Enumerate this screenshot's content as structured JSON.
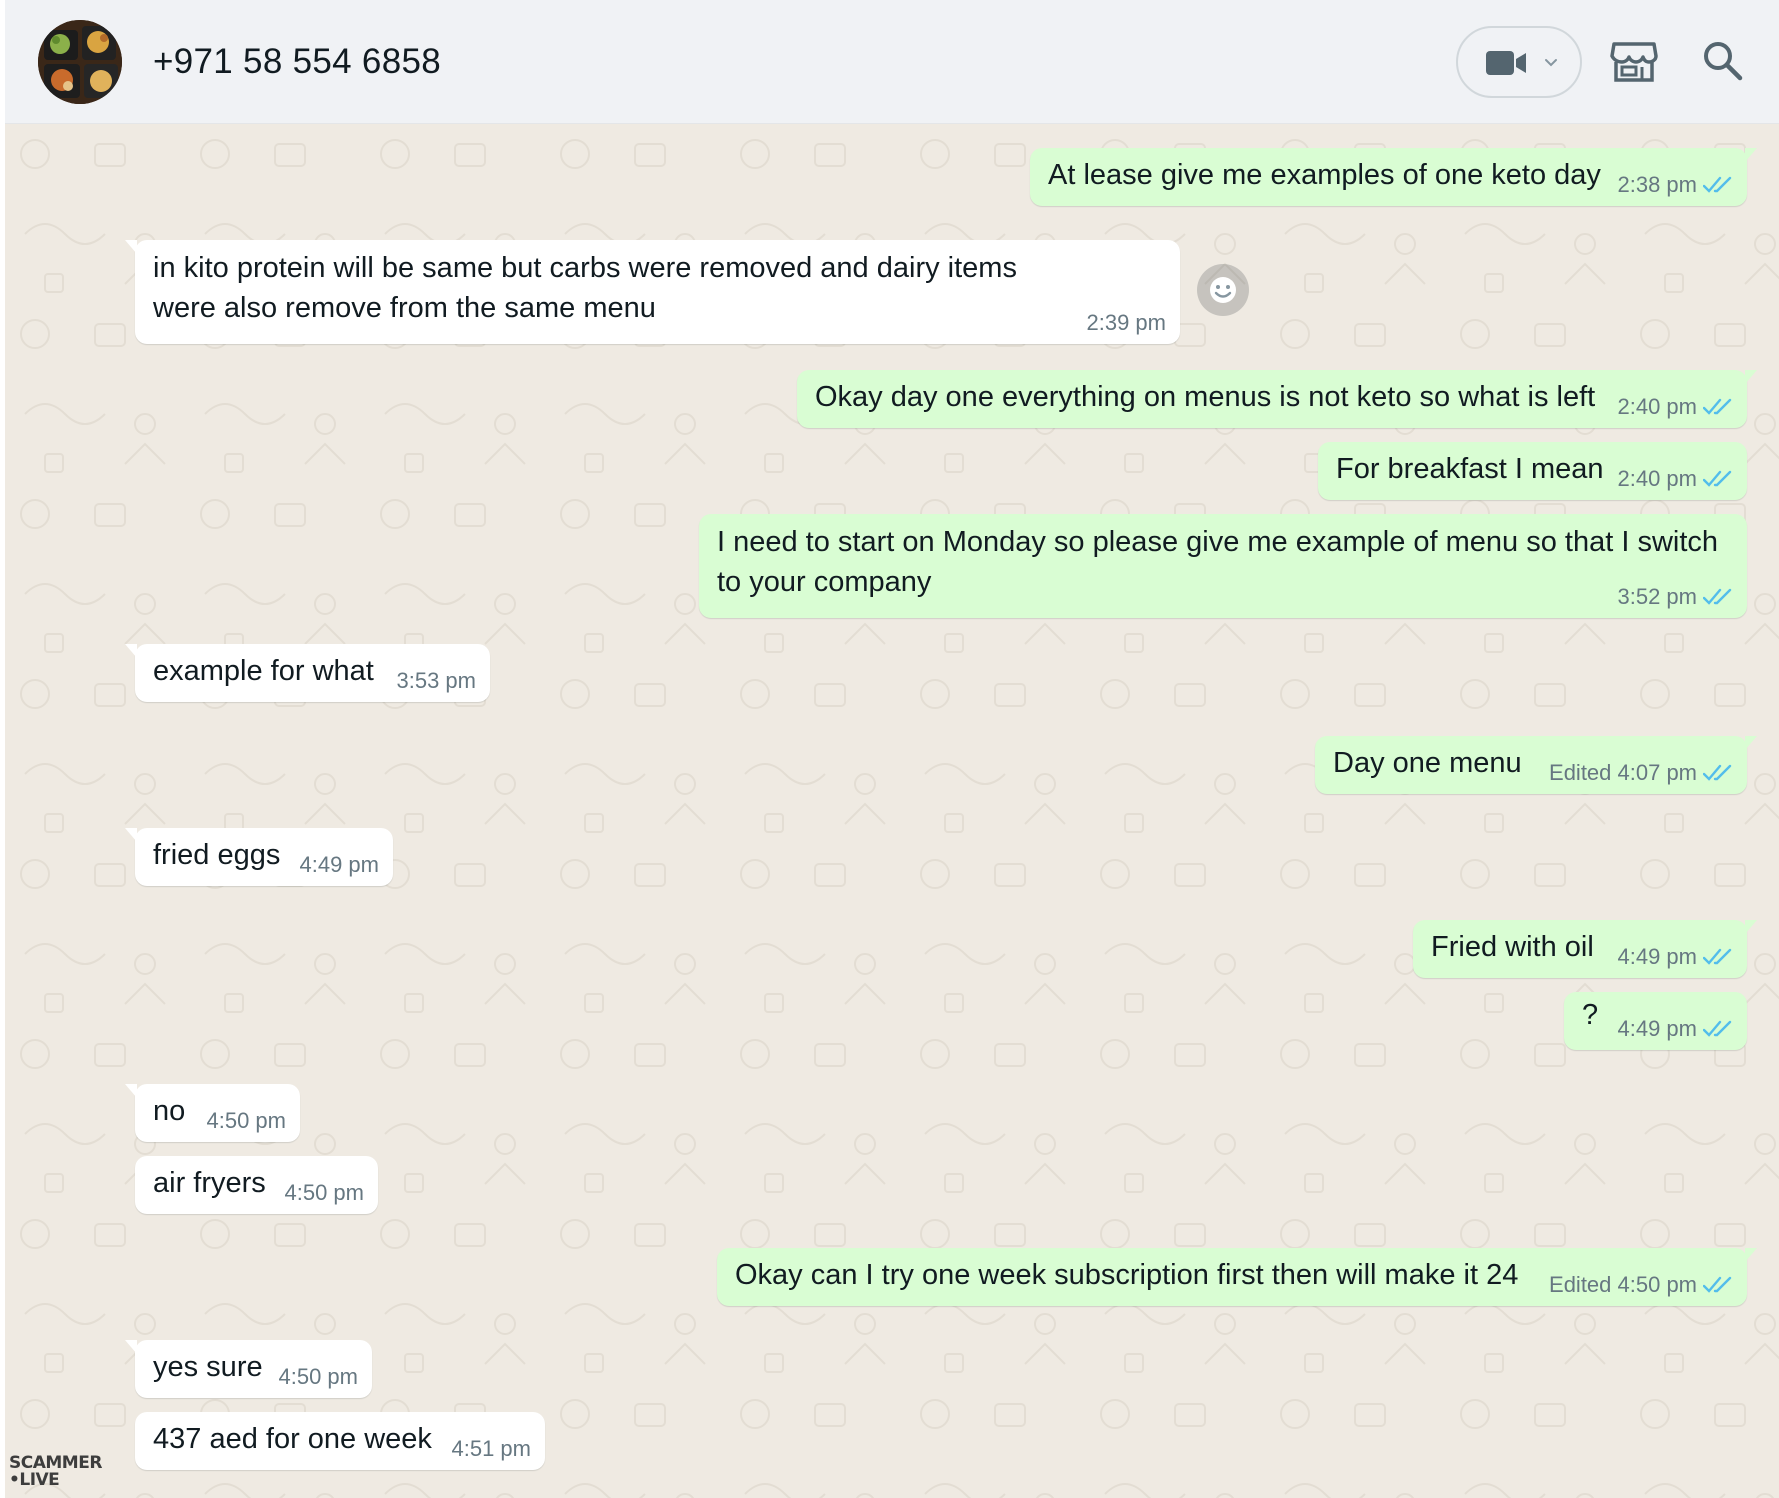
{
  "header": {
    "contact": "+971 58 554 6858",
    "icons": [
      "video-call-icon",
      "chevron-down-icon",
      "business-catalog-icon",
      "search-icon"
    ]
  },
  "colors": {
    "header_bg": "#f0f2f5",
    "chat_bg": "#efeae2",
    "outgoing_bubble": "#d9fdd3",
    "incoming_bubble": "#ffffff",
    "read_ticks": "#53bdeb",
    "meta_text": "#667781"
  },
  "messages": [
    {
      "dir": "out",
      "text": "At lease give me examples of one keto day",
      "time": "2:38 pm",
      "ticks": "read"
    },
    {
      "dir": "in",
      "text": "in kito protein will be same but carbs were removed and dairy items were also remove from the same menu",
      "time": "2:39 pm"
    },
    {
      "dir": "out",
      "text": "Okay day one everything on menus is not keto so what is left",
      "time": "2:40 pm",
      "ticks": "read"
    },
    {
      "dir": "out",
      "text": "For breakfast I mean",
      "time": "2:40 pm",
      "ticks": "read"
    },
    {
      "dir": "out",
      "text": "I need to start on Monday so please give me example of menu so that I switch to your company",
      "time": "3:52 pm",
      "ticks": "read"
    },
    {
      "dir": "in",
      "text": "example for what",
      "time": "3:53 pm"
    },
    {
      "dir": "out",
      "text": "Day one menu",
      "time": "Edited 4:07 pm",
      "ticks": "read"
    },
    {
      "dir": "in",
      "text": "fried eggs",
      "time": "4:49 pm"
    },
    {
      "dir": "out",
      "text": "Fried with oil",
      "time": "4:49 pm",
      "ticks": "read"
    },
    {
      "dir": "out",
      "text": "?",
      "time": "4:49 pm",
      "ticks": "read"
    },
    {
      "dir": "in",
      "text": "no",
      "time": "4:50 pm"
    },
    {
      "dir": "in",
      "text": "air fryers",
      "time": "4:50 pm"
    },
    {
      "dir": "out",
      "text": "Okay can I try one week subscription first then will make it 24",
      "time": "Edited 4:50 pm",
      "ticks": "read"
    },
    {
      "dir": "in",
      "text": "yes sure",
      "time": "4:50 pm"
    },
    {
      "dir": "in",
      "text": "437 aed for one week",
      "time": "4:51 pm"
    }
  ],
  "watermark": {
    "line1": "SCAMMER",
    "line2": "•LIVE"
  }
}
